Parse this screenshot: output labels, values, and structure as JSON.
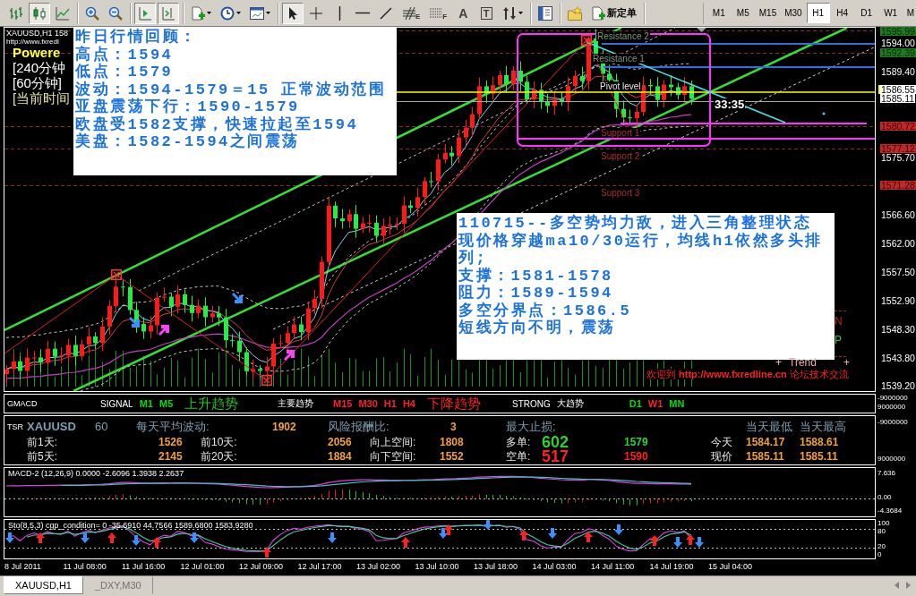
{
  "toolbar": {
    "groups": [
      [
        {
          "on": false
        },
        {
          "on": true
        },
        {
          "on": false
        }
      ],
      [
        {
          "on": false
        },
        {
          "on": false
        }
      ],
      [
        {
          "on": true
        },
        {
          "on": true
        }
      ],
      [
        {
          "on": false,
          "menu": true
        },
        {
          "on": false,
          "menu": true
        },
        {
          "on": false,
          "menu": true
        }
      ],
      [
        {
          "on": true
        },
        {
          "on": false
        },
        {
          "on": false
        },
        {
          "on": false
        },
        {
          "on": false
        },
        {
          "on": false,
          "glyph": "E"
        },
        {
          "on": false,
          "glyph": "F"
        },
        {
          "on": false,
          "glyph": "A"
        },
        {
          "on": false,
          "glyph": "T"
        },
        {
          "on": false,
          "menu": true
        }
      ],
      [
        {
          "on": false
        }
      ],
      [
        {
          "on": false
        },
        {
          "on": false,
          "label": "新定单"
        }
      ]
    ],
    "timeframes": [
      {
        "label": "M1",
        "selected": false
      },
      {
        "label": "M5",
        "selected": false
      },
      {
        "label": "M15",
        "selected": false
      },
      {
        "label": "M30",
        "selected": false
      },
      {
        "label": "H1",
        "selected": true
      },
      {
        "label": "H4",
        "selected": false
      },
      {
        "label": "D1",
        "selected": false
      },
      {
        "label": "W1",
        "selected": false
      },
      {
        "label": "M",
        "selected": false
      }
    ]
  },
  "chart": {
    "header": {
      "symbol": "XAUUSD,H1 158",
      "link": "http://www.fxredl",
      "brand": "Powere",
      "lines": [
        {
          "text": "[240分钟",
          "kind": "plain"
        },
        {
          "text": "[60分钟]",
          "kind": "plain"
        },
        {
          "text": "[当前时间",
          "kind": "time"
        }
      ]
    },
    "notes": [
      {
        "lines": [
          "昨日行情回顾：",
          "高点：1594",
          "低点：1579",
          "波动：1594-1579＝15 正常波动范围",
          "亚盘震荡下行：1590-1579",
          "欧盘受1582支撑，快速拉起至1594",
          "美盘：1582-1594之间震荡"
        ]
      },
      {
        "lines": [
          "110715--多空势均力敌，进入三角整理状态",
          "现价格穿越ma10/30运行，均线h1依然多头排列;",
          "支撑：1581-1578",
          "阻力：1589-1594",
          "多空分界点：1586.5",
          "短线方向不明，震荡"
        ]
      }
    ],
    "levels": [
      {
        "label": "Resistance 2",
        "kind": "resistance"
      },
      {
        "label": "Resistance 1",
        "kind": "resistance"
      },
      {
        "label": "Pivot level",
        "kind": "pivot"
      },
      {
        "label": "Support 1",
        "kind": "support"
      },
      {
        "label": "Support 2",
        "kind": "support"
      },
      {
        "label": "Support 3",
        "kind": "support"
      }
    ],
    "countdown": "33:35",
    "side_marks": [
      "N",
      "P"
    ],
    "legend": [
      "+",
      "Trend",
      "+"
    ],
    "banner": "欢迎到 **http://www.fxredline.cn** 论坛技术交流",
    "price_axis": [
      {
        "label": "1595.99",
        "kind": "resistance"
      },
      {
        "label": "1594.00",
        "kind": "tick"
      },
      {
        "label": "1592.39",
        "kind": "resistance"
      },
      {
        "label": "1589.40",
        "kind": "tick"
      },
      {
        "label": "1586.55",
        "kind": "pivot"
      },
      {
        "label": "1585.11",
        "kind": "bid"
      },
      {
        "label": "1580.72",
        "kind": "support"
      },
      {
        "label": "1577.12",
        "kind": "support"
      },
      {
        "label": "1575.70",
        "kind": "tick"
      },
      {
        "label": "1571.28",
        "kind": "support"
      },
      {
        "label": "1566.60",
        "kind": "tick"
      },
      {
        "label": "1562.00",
        "kind": "tick"
      },
      {
        "label": "1557.50",
        "kind": "tick"
      },
      {
        "label": "1552.90",
        "kind": "tick"
      },
      {
        "label": "1548.30",
        "kind": "tick"
      },
      {
        "label": "1543.80",
        "kind": "tick"
      },
      {
        "label": "1539.20",
        "kind": "tick"
      }
    ]
  },
  "signal_panel": {
    "title": "GMACD",
    "groups": [
      {
        "label": "SIGNAL",
        "frames": [
          {
            "name": "M1",
            "color": "#00e000"
          },
          {
            "name": "M5",
            "color": "#00e000"
          }
        ],
        "trend": {
          "text": "上升趋势",
          "color": "#20c020"
        }
      },
      {
        "note": "主要趋势",
        "frames": [
          {
            "name": "M15",
            "color": "#ff2020"
          },
          {
            "name": "M30",
            "color": "#ff2020"
          },
          {
            "name": "H1",
            "color": "#ff2020"
          },
          {
            "name": "H4",
            "color": "#ff2020"
          }
        ],
        "trend": {
          "text": "下降趋势",
          "color": "#ff2020"
        }
      },
      {
        "label": "STRONG",
        "note": "大趋势",
        "frames": [
          {
            "name": "D1",
            "color": "#00e000"
          },
          {
            "name": "W1",
            "color": "#ff2020"
          },
          {
            "name": "MN",
            "color": "#00e000"
          }
        ]
      }
    ],
    "scale": [
      "-9000000",
      "9000000"
    ]
  },
  "tsr_panel": {
    "tag": "TSR",
    "symbol": "XAUUSD",
    "period": "60",
    "stats": [
      {
        "label": "每天平均波动:",
        "value": "1902"
      },
      {
        "label": "风险报酬比:",
        "value": "3"
      }
    ],
    "stop_label": "最大止损;",
    "low_label": "当天最低",
    "high_label": "当天最高",
    "rows": [
      {
        "range_a": {
          "label": "前1天:",
          "value": "1526"
        },
        "range_b": {
          "label": "前10天:",
          "value": "2056"
        },
        "space": {
          "label": "向上空间:",
          "value": "1808"
        },
        "order": {
          "label": "多单:",
          "points": "602",
          "price": "1579",
          "color": "#30d030"
        },
        "day": {
          "label": "今天",
          "low": "1584.17",
          "high": "1588.61"
        }
      },
      {
        "range_a": {
          "label": "前5天:",
          "value": "2145"
        },
        "range_b": {
          "label": "前20天:",
          "value": "1884"
        },
        "space": {
          "label": "向下空间:",
          "value": "1552"
        },
        "order": {
          "label": "空单:",
          "points": "517",
          "price": "1590",
          "color": "#ff2020"
        },
        "day": {
          "label": "现价",
          "low": "1585.11",
          "high": "1585.11"
        }
      }
    ],
    "scale": [
      "-9000000",
      "9000000"
    ]
  },
  "macd_panel": {
    "title": "MACD-2 (12,26,9) 0.0000 -2.6096 1.3938 2.2637",
    "scale": [
      "7.636",
      "0.00",
      "-4.3684"
    ]
  },
  "stoch_panel": {
    "title": "Sto(8,5,3) cgp_condition= 0 -35.6910 44.7566 1589.6800 1583.9280",
    "scale": [
      "100",
      "80",
      "20",
      "0"
    ]
  },
  "time_axis": [
    "8 Jul 2011",
    "11 Jul 08:00",
    "11 Jul 16:00",
    "12 Jul 01:00",
    "12 Jul 09:00",
    "12 Jul 17:00",
    "13 Jul 02:00",
    "13 Jul 10:00",
    "13 Jul 18:00",
    "14 Jul 03:00",
    "14 Jul 11:00",
    "14 Jul 19:00",
    "15 Jul 04:00"
  ],
  "tabs": [
    {
      "label": "XAUUSD,H1",
      "selected": true
    },
    {
      "label": "_DXY,M30",
      "selected": false
    }
  ]
}
